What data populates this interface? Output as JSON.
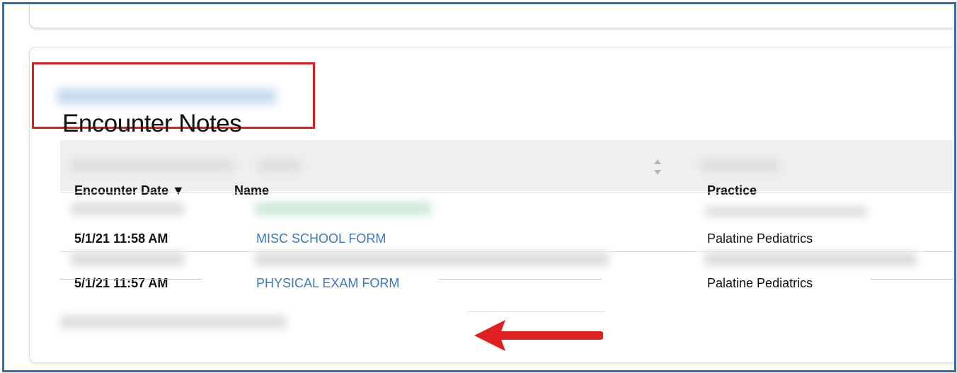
{
  "section": {
    "title": "Encounter Notes"
  },
  "table": {
    "columns": {
      "date": "Encounter Date",
      "date_sort_indicator": "▼",
      "name": "Name",
      "practice": "Practice"
    },
    "rows": [
      {
        "date": "5/1/21 11:58 AM",
        "name": "MISC SCHOOL FORM",
        "practice": "Palatine Pediatrics"
      },
      {
        "date": "5/1/21 11:57 AM",
        "name": "PHYSICAL EXAM FORM",
        "practice": "Palatine Pediatrics"
      }
    ]
  },
  "colors": {
    "frame_border": "#2a6db5",
    "highlight_box": "#e02020",
    "arrow": "#e02020",
    "link": "#3b78c1"
  },
  "icons": {
    "sort": "sort-arrows-icon",
    "annotation_arrow": "left-arrow-icon"
  }
}
